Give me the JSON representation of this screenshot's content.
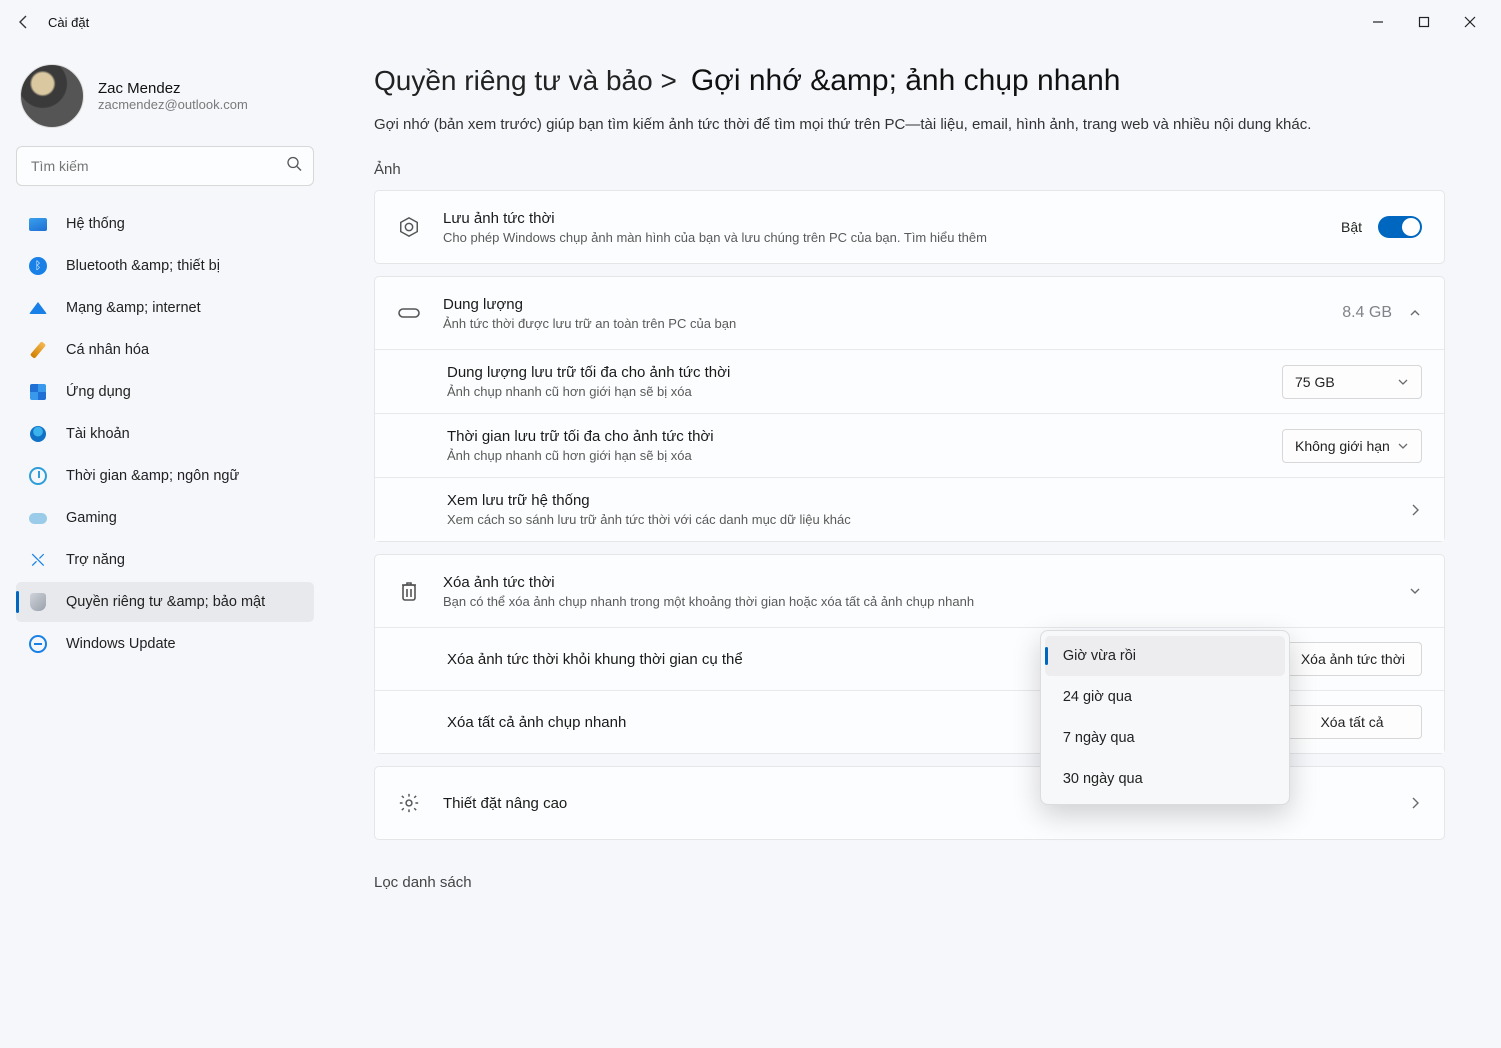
{
  "app_title": "Cài đặt",
  "user": {
    "name": "Zac Mendez",
    "email": "zacmendez@outlook.com"
  },
  "search": {
    "placeholder": "Tìm kiếm"
  },
  "nav": [
    {
      "id": "system",
      "label": "Hệ thống"
    },
    {
      "id": "bluetooth",
      "label": "Bluetooth &amp; thiết bị"
    },
    {
      "id": "network",
      "label": "Mạng &amp; internet"
    },
    {
      "id": "personalization",
      "label": "Cá nhân hóa"
    },
    {
      "id": "apps",
      "label": "Ứng dụng"
    },
    {
      "id": "accounts",
      "label": "Tài khoản"
    },
    {
      "id": "time",
      "label": "Thời gian &amp; ngôn ngữ"
    },
    {
      "id": "gaming",
      "label": "Gaming"
    },
    {
      "id": "accessibility",
      "label": "Trợ năng"
    },
    {
      "id": "privacy",
      "label": "Quyền riêng tư &amp; bảo mật"
    },
    {
      "id": "update",
      "label": "Windows Update"
    }
  ],
  "breadcrumb": {
    "parent": "Quyền riêng tư và bảo  >",
    "current": "Gợi nhớ &amp; ảnh chụp nhanh"
  },
  "page_desc": "Gợi nhớ (bản xem trước) giúp bạn tìm kiếm ảnh tức thời để tìm mọi thứ trên PC—tài liệu, email, hình ảnh, trang web và nhiều nội dung khác.",
  "section_images": "Ảnh",
  "save_snapshots": {
    "title": "Lưu ảnh tức thời",
    "sub": "Cho phép Windows chụp ảnh màn hình của bạn và lưu chúng trên PC của bạn. Tìm hiểu thêm",
    "state_label": "Bật"
  },
  "storage": {
    "title": "Dung lượng",
    "sub": "Ảnh tức thời được lưu trữ an toàn trên PC của bạn",
    "value": "8.4 GB",
    "max_storage": {
      "title": "Dung lượng lưu trữ tối đa cho ảnh tức thời",
      "sub": "Ảnh chụp nhanh cũ hơn giới hạn sẽ bị xóa",
      "value": "75 GB"
    },
    "max_duration": {
      "title": "Thời gian lưu trữ tối đa cho ảnh tức thời",
      "sub": "Ảnh chụp nhanh cũ hơn giới hạn sẽ bị xóa",
      "value": "Không giới hạn"
    },
    "view_system": {
      "title": "Xem lưu trữ hệ thống",
      "sub": "Xem cách so sánh lưu trữ ảnh tức thời với các danh mục dữ liệu khác"
    }
  },
  "delete": {
    "title": "Xóa ảnh tức thời",
    "sub": "Bạn có thể xóa ảnh chụp nhanh trong một khoảng thời gian hoặc xóa tất cả ảnh chụp nhanh",
    "from_timeframe": {
      "label": "Xóa ảnh tức thời khỏi khung thời gian cụ thể",
      "button": "Xóa ảnh tức thời"
    },
    "all": {
      "label": "Xóa tất cả ảnh chụp nhanh",
      "button": "Xóa tất cả"
    }
  },
  "advanced": {
    "title": "Thiết đặt nâng cao"
  },
  "filter_section": "Lọc danh sách",
  "timeframe_options": [
    "Giờ vừa rồi",
    "24 giờ qua",
    "7 ngày qua",
    "30 ngày qua"
  ],
  "timeframe_selected": "Giờ vừa rồi"
}
